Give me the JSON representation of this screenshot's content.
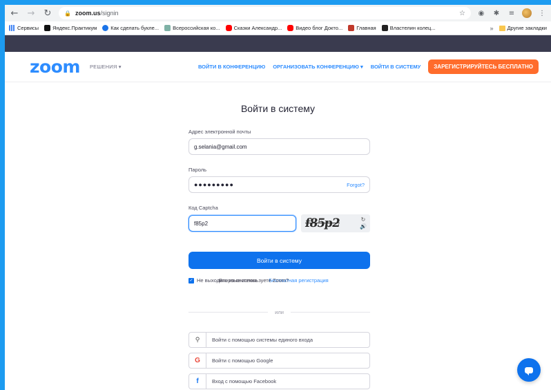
{
  "browser": {
    "url_host": "zoom.us",
    "url_path": "/signin",
    "bookmarks": [
      {
        "label": "Сервисы",
        "color": "#4285f4"
      },
      {
        "label": "Яндекс.Практикум",
        "color": "#111111"
      },
      {
        "label": "Как сделать букле...",
        "color": "#1a73e8"
      },
      {
        "label": "Всероссийская ко...",
        "color": "#7fb2a6"
      },
      {
        "label": "Сказки Александр...",
        "color": "#ff0000"
      },
      {
        "label": "Видео блог Докто...",
        "color": "#ff0000"
      },
      {
        "label": "Главная",
        "color": "#c0392b"
      },
      {
        "label": "Властелин колец...",
        "color": "#222222"
      }
    ],
    "bookmarks_more": "»",
    "other_bookmarks": "Другие закладки"
  },
  "nav": {
    "logo": "zoom",
    "solutions": "РЕШЕНИЯ ▾",
    "join": "ВОЙТИ В КОНФЕРЕНЦИЮ",
    "host": "ОРГАНИЗОВАТЬ КОНФЕРЕНЦИЮ ▾",
    "signin": "ВОЙТИ В СИСТЕМУ",
    "signup": "ЗАРЕГИСТРИРУЙТЕСЬ БЕСПЛАТНО"
  },
  "form": {
    "title": "Войти в систему",
    "email_label": "Адрес электронной почты",
    "email_value": "g.selania@gmail.com",
    "password_label": "Пароль",
    "password_value": "●●●●●●●●●",
    "forgot": "Forgot?",
    "captcha_label": "Код Captcha",
    "captcha_value": "f85p2",
    "captcha_image_text": "f85p2",
    "submit": "Войти в систему",
    "keep_signed": "Не выходить из системы",
    "new_to_zoom": "Впервые используете Zoom?",
    "register_link": "Бесплатная регистрация",
    "or": "или",
    "sso": "Войти с помощью системы единого входа",
    "google": "Войти с помощью Google",
    "facebook": "Вход с помощью Facebook"
  },
  "colors": {
    "brand_blue": "#2d8cff",
    "button_blue": "#0e72ed",
    "signup_orange": "#ff6c2c"
  }
}
